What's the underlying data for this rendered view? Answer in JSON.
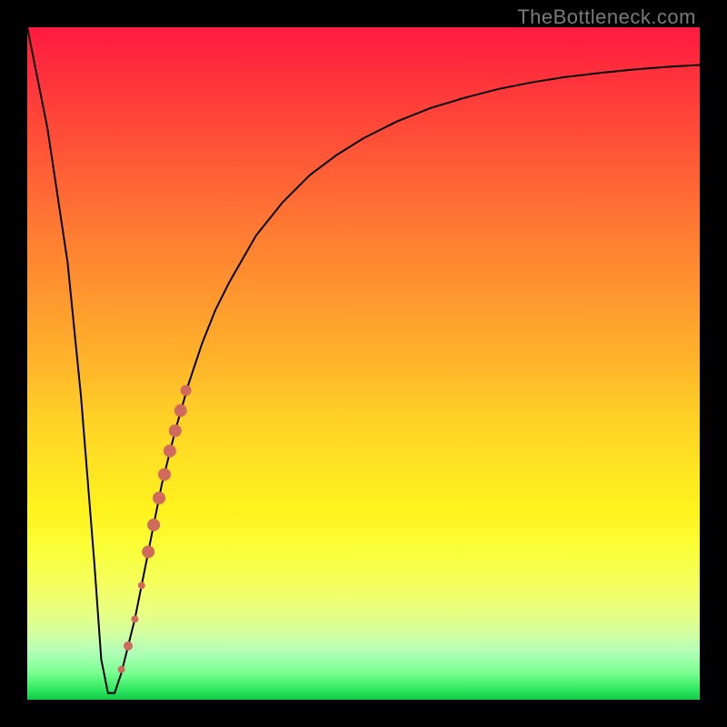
{
  "watermark": "TheBottleneck.com",
  "colors": {
    "frame": "#000000",
    "curve": "#000000",
    "marker_fill": "#d06a5e",
    "marker_stroke": "#a84f45"
  },
  "chart_data": {
    "type": "line",
    "title": "",
    "xlabel": "",
    "ylabel": "",
    "xlim": [
      0,
      100
    ],
    "ylim": [
      0,
      100
    ],
    "grid": false,
    "series": [
      {
        "name": "curve",
        "x": [
          0,
          3,
          6,
          8,
          10,
          11,
          12,
          13,
          14,
          16,
          18,
          20,
          22,
          24,
          26,
          28,
          30,
          34,
          38,
          42,
          46,
          50,
          55,
          60,
          65,
          70,
          75,
          80,
          85,
          90,
          95,
          100
        ],
        "y": [
          100,
          85,
          65,
          45,
          20,
          6,
          1,
          1,
          4,
          12,
          22,
          32,
          40,
          47,
          53,
          58,
          62,
          69,
          74,
          78,
          81,
          83.5,
          86,
          88,
          89.5,
          90.8,
          91.8,
          92.6,
          93.2,
          93.7,
          94.1,
          94.4
        ]
      }
    ],
    "markers": [
      {
        "x": 14.0,
        "y": 4.5,
        "r": 4
      },
      {
        "x": 15.0,
        "y": 8.0,
        "r": 5
      },
      {
        "x": 16.0,
        "y": 12.0,
        "r": 4
      },
      {
        "x": 17.0,
        "y": 17.0,
        "r": 4
      },
      {
        "x": 18.0,
        "y": 22.0,
        "r": 7
      },
      {
        "x": 18.8,
        "y": 26.0,
        "r": 7
      },
      {
        "x": 19.6,
        "y": 30.0,
        "r": 7
      },
      {
        "x": 20.4,
        "y": 33.5,
        "r": 7
      },
      {
        "x": 21.2,
        "y": 37.0,
        "r": 7
      },
      {
        "x": 22.0,
        "y": 40.0,
        "r": 7
      },
      {
        "x": 22.8,
        "y": 43.0,
        "r": 7
      },
      {
        "x": 23.6,
        "y": 46.0,
        "r": 6
      }
    ]
  }
}
